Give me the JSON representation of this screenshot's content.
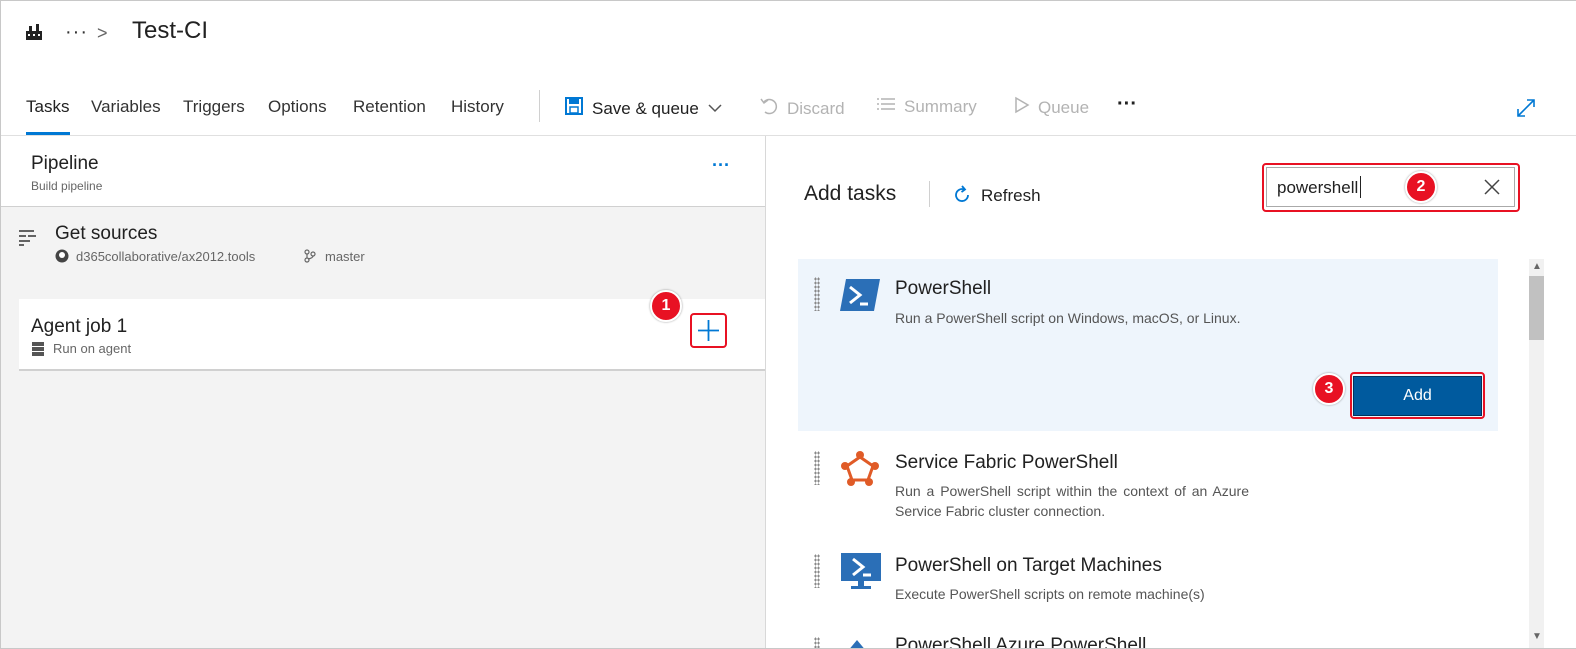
{
  "header": {
    "breadcrumb_more": "···",
    "breadcrumb_sep": ">",
    "title": "Test-CI"
  },
  "tabs": [
    "Tasks",
    "Variables",
    "Triggers",
    "Options",
    "Retention",
    "History"
  ],
  "toolbar": {
    "save_queue": "Save & queue",
    "discard": "Discard",
    "summary": "Summary",
    "queue": "Queue",
    "more": "···"
  },
  "pipeline": {
    "title": "Pipeline",
    "subtitle": "Build pipeline",
    "more": "···"
  },
  "get_sources": {
    "title": "Get sources",
    "repo": "d365collaborative/ax2012.tools",
    "branch": "master"
  },
  "agent_job": {
    "title": "Agent job 1",
    "subtitle": "Run on agent"
  },
  "add_tasks": {
    "title": "Add tasks",
    "refresh": "Refresh",
    "search_value": "powershell"
  },
  "tasks": [
    {
      "title": "PowerShell",
      "desc": "Run a PowerShell script on Windows, macOS, or Linux.",
      "icon": "powershell-icon"
    },
    {
      "title": "Service Fabric PowerShell",
      "desc": "Run a PowerShell script within the context of an Azure Service Fabric cluster connection.",
      "icon": "service-fabric-icon"
    },
    {
      "title": "PowerShell on Target Machines",
      "desc": "Execute PowerShell scripts on remote machine(s)",
      "icon": "powershell-target-icon"
    },
    {
      "title": "PowerShell Azure PowerShell",
      "desc": "",
      "icon": "azure-icon"
    }
  ],
  "add_button": "Add",
  "badges": [
    "1",
    "2",
    "3"
  ],
  "colors": {
    "accent": "#0078d4",
    "highlight": "#e81123",
    "selected_row": "#eef5fc",
    "button": "#005a9e"
  }
}
